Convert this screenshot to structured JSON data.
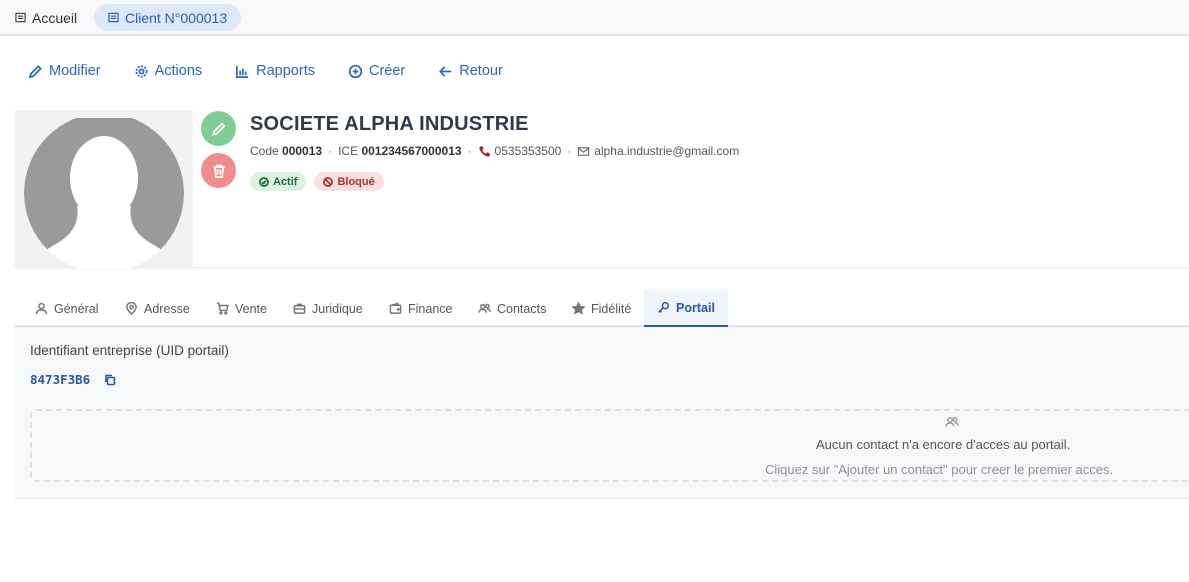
{
  "top_tabs": {
    "home": "Accueil",
    "client": "Client N°000013"
  },
  "toolbar": {
    "edit": "Modifier",
    "actions": "Actions",
    "reports": "Rapports",
    "create": "Créer",
    "back": "Retour"
  },
  "profile": {
    "name": "SOCIETE ALPHA INDUSTRIE",
    "code_label": "Code",
    "code": "000013",
    "ice_label": "ICE",
    "ice": "001234567000013",
    "phone": "0535353500",
    "email": "alpha.industrie@gmail.com",
    "badge_active": "Actif",
    "badge_blocked": "Bloqué"
  },
  "tabs": [
    {
      "label": "Général",
      "icon": "user-icon"
    },
    {
      "label": "Adresse",
      "icon": "map-pin-icon"
    },
    {
      "label": "Vente",
      "icon": "cart-icon"
    },
    {
      "label": "Juridique",
      "icon": "briefcase-icon"
    },
    {
      "label": "Finance",
      "icon": "wallet-icon"
    },
    {
      "label": "Contacts",
      "icon": "users-icon"
    },
    {
      "label": "Fidélité",
      "icon": "star-icon"
    },
    {
      "label": "Portail",
      "icon": "key-icon",
      "active": true
    }
  ],
  "portal": {
    "uid_label": "Identifiant entreprise (UID portail)",
    "uid_value": "8473F3B6",
    "empty_title": "Aucun contact n'a encore d'acces au portail.",
    "empty_hint": "Cliquez sur \"Ajouter un contact\" pour creer le premier acces."
  },
  "colors": {
    "accent": "#2d63c8",
    "success": "#7fcf95",
    "danger": "#ef8c8c"
  }
}
